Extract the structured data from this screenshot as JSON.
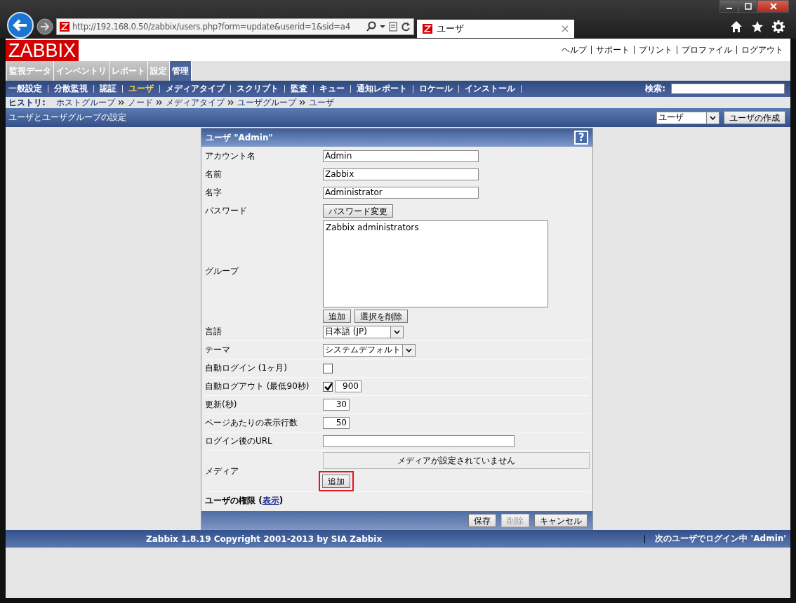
{
  "browser": {
    "url": "http://192.168.0.50/zabbix/users.php?form=update&userid=1&sid=a4",
    "tab_title": "ユーザ"
  },
  "header": {
    "logo": "ZABBIX",
    "links": [
      "ヘルプ",
      "サポート",
      "プリント",
      "プロファイル",
      "ログアウト"
    ]
  },
  "main_menu": [
    {
      "label": "監視データ",
      "selected": false
    },
    {
      "label": "インベントリ",
      "selected": false
    },
    {
      "label": "レポート",
      "selected": false
    },
    {
      "label": "設定",
      "selected": false
    },
    {
      "label": "管理",
      "selected": true
    }
  ],
  "sub_menu": [
    {
      "label": "一般設定",
      "selected": false
    },
    {
      "label": "分散監視",
      "selected": false
    },
    {
      "label": "認証",
      "selected": false
    },
    {
      "label": "ユーザ",
      "selected": true
    },
    {
      "label": "メディアタイプ",
      "selected": false
    },
    {
      "label": "スクリプト",
      "selected": false
    },
    {
      "label": "監査",
      "selected": false
    },
    {
      "label": "キュー",
      "selected": false
    },
    {
      "label": "通知レポート",
      "selected": false
    },
    {
      "label": "ロケール",
      "selected": false
    },
    {
      "label": "インストール",
      "selected": false
    }
  ],
  "search": {
    "label": "検索:"
  },
  "history": {
    "label": "ヒストリ:",
    "items": [
      "ホストグループ",
      "ノード",
      "メディアタイプ",
      "ユーザグループ",
      "ユーザ"
    ]
  },
  "title_bar": {
    "title": "ユーザとユーザグループの設定",
    "select": "ユーザ",
    "button": "ユーザの作成"
  },
  "form": {
    "title": "ユーザ \"Admin\"",
    "help": "?",
    "rows": [
      {
        "kind": "text",
        "label": "アカウント名",
        "value": "Admin"
      },
      {
        "kind": "text",
        "label": "名前",
        "value": "Zabbix"
      },
      {
        "kind": "text",
        "label": "名字",
        "value": "Administrator"
      },
      {
        "kind": "button",
        "label": "パスワード",
        "button": "パスワード変更"
      },
      {
        "kind": "listbox",
        "label": "グループ",
        "items": [
          "Zabbix administrators"
        ],
        "buttons": [
          "追加",
          "選択を削除"
        ]
      },
      {
        "kind": "select",
        "label": "言語",
        "value": "日本語 (JP)"
      },
      {
        "kind": "select",
        "label": "テーマ",
        "value": "システムデフォルト"
      },
      {
        "kind": "checkbox",
        "label": "自動ログイン (1ヶ月)",
        "checked": false
      },
      {
        "kind": "checkbox",
        "label": "自動ログアウト (最低90秒)",
        "checked": true,
        "value": "900"
      },
      {
        "kind": "number",
        "label": "更新(秒)",
        "value": "30"
      },
      {
        "kind": "number",
        "label": "ページあたりの表示行数",
        "value": "50"
      },
      {
        "kind": "url",
        "label": "ログイン後のURL"
      },
      {
        "kind": "media",
        "label": "メディア",
        "message": "メディアが設定されていません",
        "button": "追加",
        "highlighted": true
      }
    ],
    "permissions": {
      "prefix": "ユーザの権限 (",
      "link": "表示",
      "suffix": ")"
    },
    "buttons": [
      {
        "label": "保存",
        "disabled": false
      },
      {
        "label": "削除",
        "disabled": true
      },
      {
        "label": "キャンセル",
        "disabled": false
      }
    ]
  },
  "footer": {
    "copyright": "Zabbix 1.8.19 Copyright 2001-2013 by SIA Zabbix",
    "login": "次のユーザでログイン中 'Admin'"
  }
}
